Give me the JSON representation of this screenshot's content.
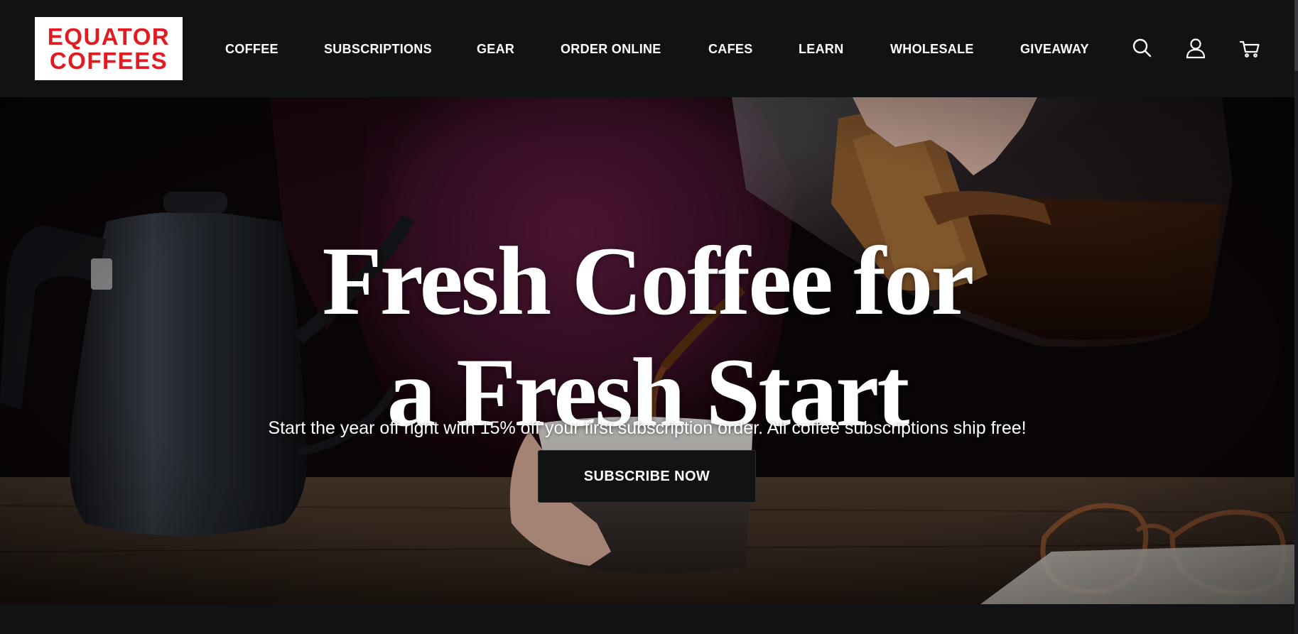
{
  "brand": {
    "logo_line1": "EQUATOR",
    "logo_line2": "COFFEES",
    "logo_color": "#e21b23"
  },
  "nav": {
    "items": [
      {
        "label": "COFFEE"
      },
      {
        "label": "SUBSCRIPTIONS"
      },
      {
        "label": "GEAR"
      },
      {
        "label": "ORDER ONLINE"
      },
      {
        "label": "CAFES"
      },
      {
        "label": "LEARN"
      },
      {
        "label": "WHOLESALE"
      },
      {
        "label": "GIVEAWAY"
      }
    ],
    "icons": [
      "search-icon",
      "user-icon",
      "cart-icon"
    ]
  },
  "hero": {
    "title_line1": "Fresh Coffee for",
    "title_line2": "a Fresh Start",
    "subtitle": "Start the year off right with 15% off your first subscription order. All coffee subscriptions ship free!",
    "cta_label": "SUBSCRIBE NOW"
  },
  "colors": {
    "header_bg": "#111214",
    "text": "#ffffff",
    "accent_red": "#e21b23",
    "button_bg": "#111214"
  }
}
